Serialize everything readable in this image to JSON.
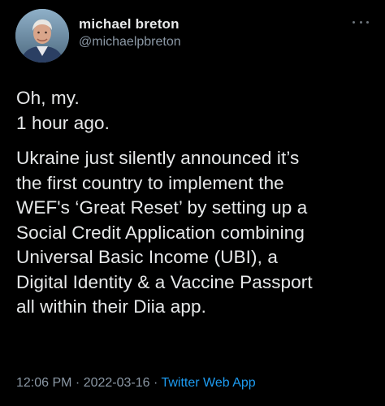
{
  "author": {
    "display_name": "michael breton",
    "handle": "@michaelpbreton"
  },
  "icons": {
    "avatar": "profile-photo",
    "more": "more-horizontal-icon"
  },
  "tweet": {
    "lines": [
      "Oh, my.",
      "1 hour ago."
    ],
    "paragraph": [
      "Ukraine just silently announced it’s",
      "the first country to implement the",
      "WEF's ‘Great Reset’ by setting up a",
      "Social Credit Application combining",
      "Universal Basic Income (UBI), a",
      "Digital Identity & a Vaccine Passport",
      "all within their Diia app."
    ]
  },
  "meta": {
    "time": "12:06 PM",
    "separator": " · ",
    "date": "2022-03-16",
    "source": "Twitter Web App"
  },
  "colors": {
    "background": "#000000",
    "text": "#e7e9ea",
    "secondary": "#8b98a5",
    "link": "#1d9bf0"
  }
}
